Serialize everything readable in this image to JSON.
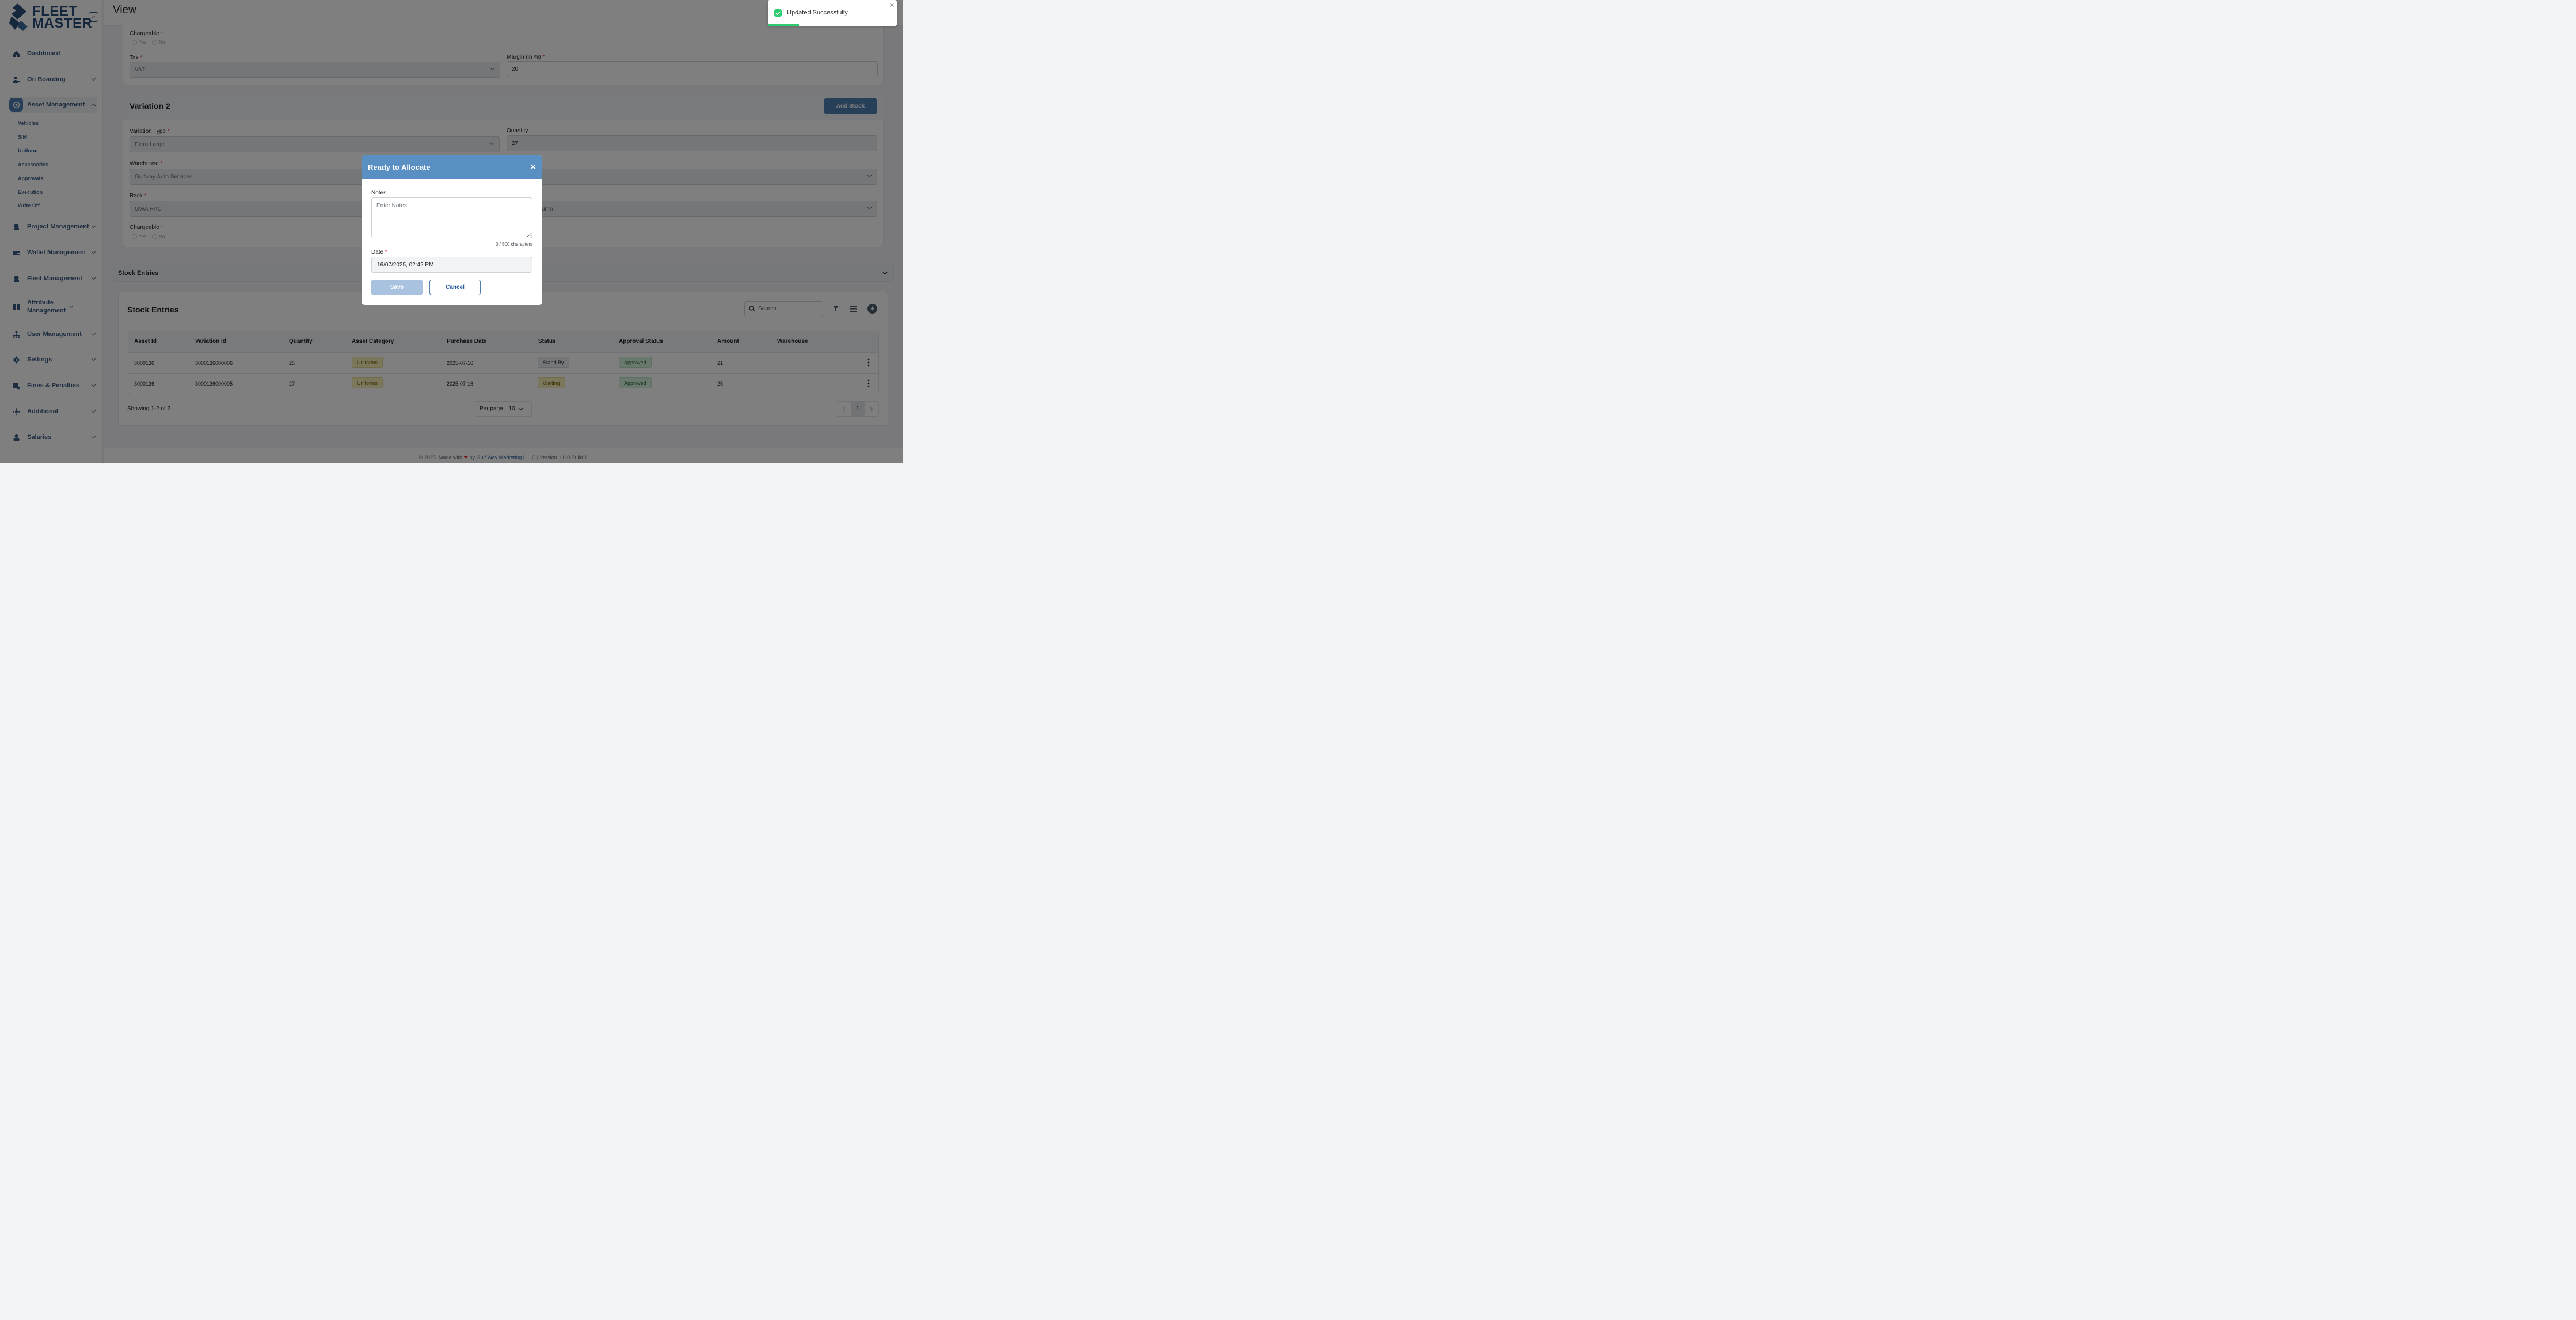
{
  "brand": {
    "line1": "FLEET",
    "line2": "MASTER"
  },
  "header": {
    "title": "View"
  },
  "sidebar": {
    "items": [
      {
        "label": "Dashboard",
        "icon": "home-icon"
      },
      {
        "label": "On Boarding",
        "icon": "user-onboard-icon"
      },
      {
        "label": "Asset Management",
        "icon": "asset-icon"
      },
      {
        "label": "Project Management",
        "icon": "project-icon"
      },
      {
        "label": "Wallet Management",
        "icon": "wallet-icon"
      },
      {
        "label": "Fleet Management",
        "icon": "fleet-icon"
      },
      {
        "label": "Attribute Management",
        "icon": "attribute-icon"
      },
      {
        "label": "User Management",
        "icon": "users-icon"
      },
      {
        "label": "Settings",
        "icon": "gear-icon"
      },
      {
        "label": "Fines & Penalties",
        "icon": "fines-icon"
      },
      {
        "label": "Additional",
        "icon": "additional-icon"
      },
      {
        "label": "Salaries",
        "icon": "salaries-icon"
      }
    ],
    "asset_sub": [
      "Vehicles",
      "SIM",
      "Uniform",
      "Accessories",
      "Approvals",
      "Execution",
      "Write Off"
    ],
    "active_sub": "Uniform"
  },
  "variation1": {
    "chargeable_label": "Chargeable",
    "yes": "Yes",
    "no": "No",
    "tax_label": "Tax",
    "tax_value": "VAT",
    "margin_label": "Margin (in %)",
    "margin_value": "20"
  },
  "variation2": {
    "title": "Variation 2",
    "add_stock": "Add Stock",
    "type_label": "Variation Type",
    "type_value": "Extra Large",
    "quantity_label": "Quantity",
    "quantity_value": "27",
    "warehouse_label": "Warehouse",
    "warehouse_value": "Gulfway Auto Services",
    "rack_label": "Rack",
    "rack_value": "GWA RAC",
    "column_value": "umn",
    "chargeable_label": "Chargeable",
    "yes": "Yes",
    "no": "No"
  },
  "stock_section": {
    "title": "Stock Entries"
  },
  "stock_table": {
    "title": "Stock Entries",
    "search_placeholder": "Search",
    "columns": [
      "Asset Id",
      "Variation Id",
      "Quantity",
      "Asset Category",
      "Purchase Date",
      "Status",
      "Approval Status",
      "Amount",
      "Warehouse"
    ],
    "rows": [
      {
        "asset_id": "3000136",
        "variation_id": "3000136000006",
        "quantity": "25",
        "category": "Uniforms",
        "date": "2025-07-16",
        "status": "Stand By",
        "approval": "Approved",
        "amount": "21",
        "warehouse": ""
      },
      {
        "asset_id": "3000136",
        "variation_id": "3000136000005",
        "quantity": "27",
        "category": "Uniforms",
        "date": "2025-07-16",
        "status": "Waiting",
        "approval": "Approved",
        "amount": "25",
        "warehouse": ""
      }
    ],
    "showing": "Showing 1-2 of 2",
    "per_page_label": "Per page",
    "per_page_value": "10",
    "page": "1"
  },
  "modal": {
    "title": "Ready to Allocate",
    "notes_label": "Notes",
    "notes_placeholder": "Enter Notes",
    "counter": "0 / 500 characters",
    "date_label": "Date",
    "date_value": "16/07/2025, 02:42 PM",
    "save": "Save",
    "cancel": "Cancel"
  },
  "toast": {
    "message": "Updated Successfully",
    "progress": 0.24
  },
  "footer": {
    "prefix": "© 2025. Made with",
    "by": "by",
    "company": "Gulf Way Marketing L.L.C",
    "version": "| Version 1.0.0 Build 1"
  },
  "colors": {
    "accent": "#4f7fb0",
    "modal_header": "#5a8fc4",
    "success": "#2ecc71"
  }
}
